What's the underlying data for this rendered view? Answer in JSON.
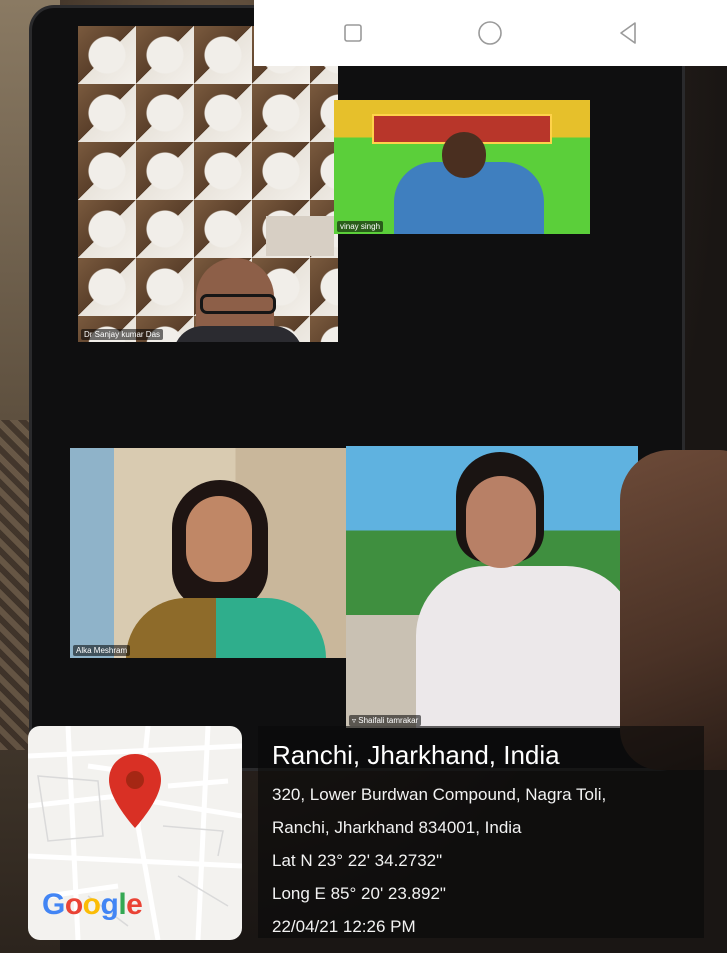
{
  "nav_bar": {
    "icons": [
      "square-icon",
      "circle-icon",
      "back-triangle-icon"
    ]
  },
  "meeting": {
    "participants": [
      {
        "name": "Dr Sanjay kumar Das"
      },
      {
        "name": "vinay singh"
      },
      {
        "name": "Alka Meshram"
      },
      {
        "name": "Shaifali tamrakar"
      }
    ]
  },
  "geo_tag": {
    "map_logo": "Google",
    "city": "Ranchi, Jharkhand, India",
    "address_line1": "320, Lower Burdwan Compound, Nagra Toli,",
    "address_line2": "Ranchi, Jharkhand 834001, India",
    "latitude": "Lat N 23° 22' 34.2732\"",
    "longitude": "Long E 85° 20' 23.892\"",
    "timestamp": "22/04/21 12:26 PM",
    "pin_color": "#d93025"
  }
}
